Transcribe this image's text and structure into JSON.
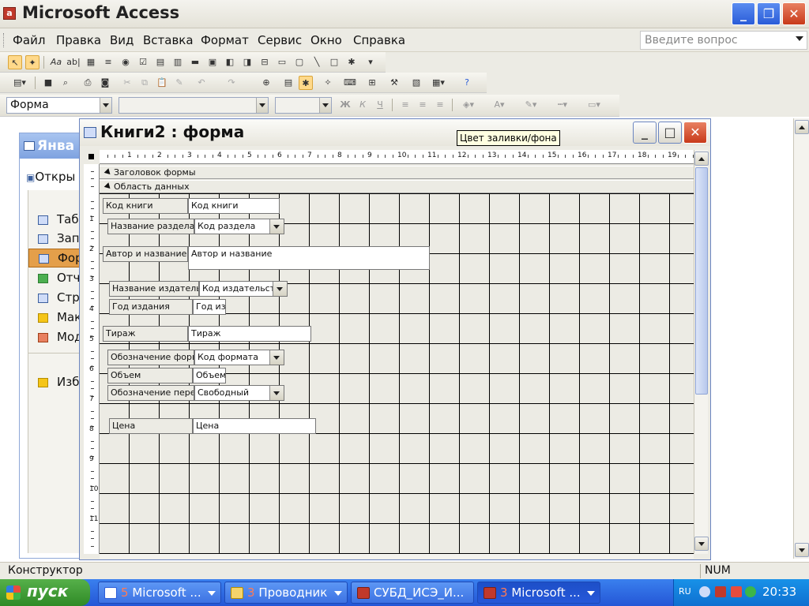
{
  "app": {
    "title": "Microsoft Access",
    "icon": "access-app-icon"
  },
  "menu": {
    "items": [
      "Файл",
      "Правка",
      "Вид",
      "Вставка",
      "Формат",
      "Сервис",
      "Окно",
      "Справка"
    ],
    "underline": [
      "Ф",
      "П",
      "В",
      "а",
      "Ф",
      "С",
      "О",
      "С"
    ],
    "ask_placeholder": "Введите вопрос"
  },
  "format_toolbar": {
    "object_combo": "Форма",
    "bold": "Ж",
    "italic": "К",
    "underline": "Ч",
    "font_color": "A"
  },
  "tooltip": "Цвет заливки/фона",
  "db_window": {
    "title": "Янва",
    "open_label": "Откры",
    "group_label": "О",
    "objects": [
      "Таб",
      "Зап",
      "Фор",
      "Отч",
      "Стр",
      "Мак",
      "Мод"
    ],
    "active_index": 2,
    "favorites": "Изб"
  },
  "form_window": {
    "title": "Книги2 : форма",
    "ruler_numbers": [
      "1",
      "2",
      "3",
      "4",
      "5",
      "6",
      "7",
      "8",
      "9",
      "10",
      "11",
      "12",
      "13",
      "14",
      "15",
      "16",
      "17",
      "18",
      "19"
    ],
    "vruler_numbers": [
      "1",
      "2",
      "3",
      "4",
      "5",
      "6",
      "7",
      "8",
      "9",
      "10",
      "11"
    ],
    "sections": {
      "header": "Заголовок формы",
      "detail": "Область данных"
    },
    "controls": [
      {
        "label": "Код книги",
        "field": "Код книги",
        "kind": "text"
      },
      {
        "label": "Название раздела",
        "field": "Код раздела",
        "kind": "combo"
      },
      {
        "label": "Автор и название",
        "field": "Автор и название",
        "kind": "text"
      },
      {
        "label": "Название издательства",
        "field": "Код издательства",
        "kind": "combo"
      },
      {
        "label": "Год издания",
        "field": "Год издания",
        "kind": "text"
      },
      {
        "label": "Тираж",
        "field": "Тираж",
        "kind": "text"
      },
      {
        "label": "Обозначение формата",
        "field": "Код формата",
        "kind": "combo"
      },
      {
        "label": "Объем",
        "field": "Объем",
        "kind": "text"
      },
      {
        "label": "Обозначение переплета",
        "field": "Свободный",
        "kind": "combo"
      },
      {
        "label": "Цена",
        "field": "Цена",
        "kind": "text"
      }
    ]
  },
  "statusbar": {
    "mode": "Конструктор",
    "num": "NUM"
  },
  "taskbar": {
    "start": "пуск",
    "tasks": [
      {
        "count": "5",
        "label": "Microsoft ...",
        "icon": "word-icon"
      },
      {
        "count": "3",
        "label": "Проводник",
        "icon": "folder-icon"
      },
      {
        "count": "",
        "label": "СУБД_ИСЭ_И...",
        "icon": "access-doc-icon"
      },
      {
        "count": "3",
        "label": "Microsoft ...",
        "icon": "access-app-icon"
      }
    ],
    "lang": "RU",
    "clock": "20:33"
  }
}
